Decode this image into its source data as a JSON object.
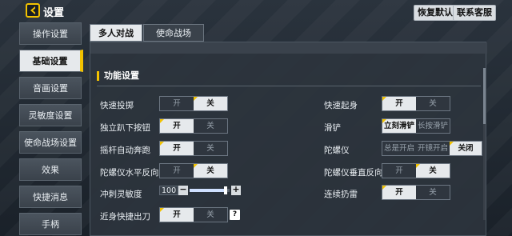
{
  "header": {
    "title": "设置",
    "restore_label": "恢复默认",
    "support_label": "联系客服"
  },
  "sidebar": {
    "items": [
      {
        "label": "操作设置"
      },
      {
        "label": "基础设置"
      },
      {
        "label": "音画设置"
      },
      {
        "label": "灵敏度设置"
      },
      {
        "label": "使命战场设置"
      },
      {
        "label": "效果"
      },
      {
        "label": "快捷消息"
      },
      {
        "label": "手柄"
      }
    ],
    "active_index": 1
  },
  "tabs": [
    {
      "label": "多人对战"
    },
    {
      "label": "使命战场"
    }
  ],
  "section": {
    "title": "功能设置"
  },
  "settings": {
    "quick_throw": {
      "label": "快速投掷",
      "options": [
        "开",
        "关"
      ],
      "selected": "关"
    },
    "prone_button": {
      "label": "独立趴下按钮",
      "options": [
        "开",
        "关"
      ],
      "selected": "开"
    },
    "joystick_sprint": {
      "label": "摇杆自动奔跑",
      "options": [
        "开",
        "关"
      ],
      "selected": "开"
    },
    "gyro_horizontal_invert": {
      "label": "陀螺仪水平反向",
      "options": [
        "开",
        "关"
      ],
      "selected": "关"
    },
    "sprint_sensitivity": {
      "label": "冲刺灵敏度",
      "value": "100",
      "minus": "−",
      "plus": "+"
    },
    "melee_quick_blade": {
      "label": "近身快捷出刀",
      "options": [
        "开",
        "关"
      ],
      "selected": "开",
      "help": "?"
    },
    "quick_rise": {
      "label": "快速起身",
      "options": [
        "开",
        "关"
      ],
      "selected": "开"
    },
    "slide": {
      "label": "滑铲",
      "options": [
        "立刻滑铲",
        "长按滑铲"
      ],
      "selected": "立刻滑铲"
    },
    "gyroscope": {
      "label": "陀螺仪",
      "options": [
        "总是开启",
        "开镜开启",
        "关闭"
      ],
      "selected": "关闭"
    },
    "gyro_vertical_invert": {
      "label": "陀螺仪垂直反向",
      "options": [
        "开",
        "关"
      ],
      "selected": "关"
    },
    "continuous_grenade": {
      "label": "连续扔雷",
      "options": [
        "开",
        "关"
      ],
      "selected": "开"
    }
  },
  "slider_level": 0.9,
  "colors": {
    "accent": "#f2c200",
    "active_bg": "#e6e9ec",
    "panel_bg": "#2c343d"
  },
  "icons": {
    "back": "back-arrow-icon"
  }
}
